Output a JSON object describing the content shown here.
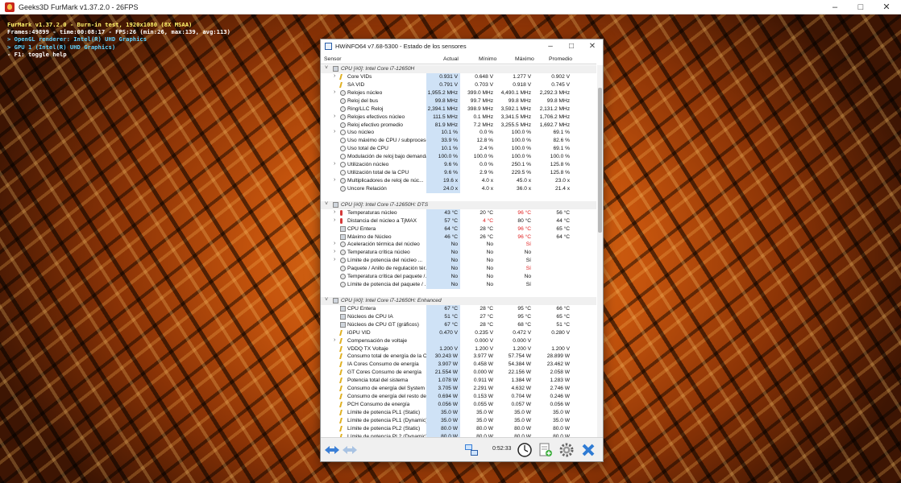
{
  "furmark": {
    "title": "Geeks3D FurMark v1.37.2.0 - 26FPS",
    "overlay": [
      {
        "text": "FurMark v1.37.2.0 - Burn-in test, 1920x1080 (8X MSAA)",
        "color": "yellow"
      },
      {
        "text": "Frames:49899 - time:00:08:17 - FPS:26 (min:26, max:139, avg:113)",
        "color": "white"
      },
      {
        "text": "> OpenGL renderer: Intel(R) UHD Graphics",
        "color": "cyan"
      },
      {
        "text": "> GPU 1 (Intel(R) UHD Graphics)",
        "color": "cyan"
      },
      {
        "text": "- F1: toggle help",
        "color": "white"
      }
    ]
  },
  "hwinfo": {
    "title": "HWiNFO64 v7.68-5300 - Estado de los sensores",
    "columns": {
      "sensor": "Sensor",
      "actual": "Actual",
      "min": "Mínimo",
      "max": "Máximo",
      "avg": "Promedio"
    },
    "rows": [
      {
        "type": "group",
        "name": "CPU [#0]: Intel Core i7-12650H"
      },
      {
        "type": "row",
        "exp": true,
        "icon": "volt",
        "name": "Core VIDs",
        "act": "0.931 V",
        "min": "0.648 V",
        "max": "1.277 V",
        "avg": "0.902 V"
      },
      {
        "type": "row",
        "exp": false,
        "icon": "volt",
        "name": "SA VID",
        "act": "0.791 V",
        "min": "0.703 V",
        "max": "0.918 V",
        "avg": "0.745 V"
      },
      {
        "type": "row",
        "exp": true,
        "icon": "clock",
        "name": "Relojes núcleo",
        "act": "1,955.2 MHz",
        "min": "399.0 MHz",
        "max": "4,490.1 MHz",
        "avg": "2,292.3 MHz"
      },
      {
        "type": "row",
        "exp": false,
        "icon": "clock",
        "name": "Reloj del bus",
        "act": "99.8 MHz",
        "min": "99.7 MHz",
        "max": "99.8 MHz",
        "avg": "99.8 MHz"
      },
      {
        "type": "row",
        "exp": false,
        "icon": "clock",
        "name": "Ring/LLC Reloj",
        "act": "2,394.1 MHz",
        "min": "398.9 MHz",
        "max": "3,592.1 MHz",
        "avg": "2,131.2 MHz"
      },
      {
        "type": "row",
        "exp": true,
        "icon": "clock",
        "name": "Relojes efectivos núcleo",
        "act": "111.5 MHz",
        "min": "0.1 MHz",
        "max": "3,341.5 MHz",
        "avg": "1,706.2 MHz"
      },
      {
        "type": "row",
        "exp": false,
        "icon": "clock",
        "name": "Reloj efectivo promedio",
        "act": "81.9 MHz",
        "min": "7.2 MHz",
        "max": "3,255.5 MHz",
        "avg": "1,692.7 MHz"
      },
      {
        "type": "row",
        "exp": true,
        "icon": "pct",
        "name": "Uso núcleo",
        "act": "10.1 %",
        "min": "0.0 %",
        "max": "100.0 %",
        "avg": "69.1 %"
      },
      {
        "type": "row",
        "exp": false,
        "icon": "pct",
        "name": "Uso máximo de CPU / subproceso",
        "act": "33.9 %",
        "min": "12.8 %",
        "max": "100.0 %",
        "avg": "82.6 %"
      },
      {
        "type": "row",
        "exp": false,
        "icon": "pct",
        "name": "Uso total de CPU",
        "act": "10.1 %",
        "min": "2.4 %",
        "max": "100.0 %",
        "avg": "69.1 %"
      },
      {
        "type": "row",
        "exp": false,
        "icon": "pct",
        "name": "Modulación de reloj bajo demanda",
        "act": "100.0 %",
        "min": "100.0 %",
        "max": "100.0 %",
        "avg": "100.0 %"
      },
      {
        "type": "row",
        "exp": true,
        "icon": "pct",
        "name": "Utilización núcleo",
        "act": "9.6 %",
        "min": "0.0 %",
        "max": "250.1 %",
        "avg": "125.8 %"
      },
      {
        "type": "row",
        "exp": false,
        "icon": "pct",
        "name": "Utilización total de la CPU",
        "act": "9.6 %",
        "min": "2.9 %",
        "max": "229.5 %",
        "avg": "125.8 %"
      },
      {
        "type": "row",
        "exp": true,
        "icon": "clock",
        "name": "Multiplicadores de reloj de núc...",
        "act": "19.6 x",
        "min": "4.0 x",
        "max": "45.0 x",
        "avg": "23.0 x"
      },
      {
        "type": "row",
        "exp": false,
        "icon": "clock",
        "name": "Uncore Relación",
        "act": "24.0 x",
        "min": "4.0 x",
        "max": "36.0 x",
        "avg": "21.4 x"
      },
      {
        "type": "spacer"
      },
      {
        "type": "group",
        "name": "CPU [#0]: Intel Core i7-12650H: DTS"
      },
      {
        "type": "row",
        "exp": true,
        "icon": "therm",
        "name": "Temperaturas núcleo",
        "act": "43 °C",
        "min": "20 °C",
        "max": "96 °C",
        "avg": "56 °C",
        "maxRed": true
      },
      {
        "type": "row",
        "exp": true,
        "icon": "therm",
        "name": "Distancia del núcleo a TjMAX",
        "act": "57 °C",
        "min": "4 °C",
        "max": "80 °C",
        "avg": "44 °C",
        "minRed": true
      },
      {
        "type": "row",
        "exp": false,
        "icon": "chip",
        "name": "CPU Entera",
        "act": "64 °C",
        "min": "28 °C",
        "max": "96 °C",
        "avg": "65 °C",
        "maxRed": true
      },
      {
        "type": "row",
        "exp": false,
        "icon": "chip",
        "name": "Máximo de Núcleo",
        "act": "46 °C",
        "min": "26 °C",
        "max": "96 °C",
        "avg": "64 °C",
        "maxRed": true
      },
      {
        "type": "row",
        "exp": true,
        "icon": "clock",
        "name": "Aceleración térmica del núcleo",
        "act": "No",
        "min": "No",
        "max": "Sí",
        "avg": "",
        "maxRed": true
      },
      {
        "type": "row",
        "exp": true,
        "icon": "clock",
        "name": "Temperatura crítica núcleo",
        "act": "No",
        "min": "No",
        "max": "No",
        "avg": ""
      },
      {
        "type": "row",
        "exp": true,
        "icon": "clock",
        "name": "Límite de potencia del núcleo ...",
        "act": "No",
        "min": "No",
        "max": "Sí",
        "avg": ""
      },
      {
        "type": "row",
        "exp": false,
        "icon": "clock",
        "name": "Paquete / Anillo de regulación tér...",
        "act": "No",
        "min": "No",
        "max": "Sí",
        "avg": "",
        "maxRed": true
      },
      {
        "type": "row",
        "exp": false,
        "icon": "clock",
        "name": "Temperatura crítica del paquete /...",
        "act": "No",
        "min": "No",
        "max": "No",
        "avg": ""
      },
      {
        "type": "row",
        "exp": false,
        "icon": "clock",
        "name": "Límite de potencia del paquete / ...",
        "act": "No",
        "min": "No",
        "max": "Sí",
        "avg": ""
      },
      {
        "type": "spacer"
      },
      {
        "type": "group",
        "name": "CPU [#0]: Intel Core i7-12650H: Enhanced"
      },
      {
        "type": "row",
        "exp": false,
        "icon": "chip",
        "name": "CPU Entera",
        "act": "67 °C",
        "min": "28 °C",
        "max": "95 °C",
        "avg": "66 °C"
      },
      {
        "type": "row",
        "exp": false,
        "icon": "chip",
        "name": "Núcleos de CPU IA",
        "act": "51 °C",
        "min": "27 °C",
        "max": "95 °C",
        "avg": "65 °C"
      },
      {
        "type": "row",
        "exp": false,
        "icon": "chip",
        "name": "Núcleos de CPU GT (gráficos)",
        "act": "67 °C",
        "min": "28 °C",
        "max": "68 °C",
        "avg": "51 °C"
      },
      {
        "type": "row",
        "exp": false,
        "icon": "volt",
        "name": "iGPU VID",
        "act": "0.470 V",
        "min": "0.235 V",
        "max": "0.472 V",
        "avg": "0.280 V"
      },
      {
        "type": "row",
        "exp": true,
        "icon": "volt",
        "name": "Compensación de voltaje",
        "act": "",
        "min": "0.000 V",
        "max": "0.000 V",
        "avg": ""
      },
      {
        "type": "row",
        "exp": false,
        "icon": "volt",
        "name": "VDDQ TX Voltaje",
        "act": "1.200 V",
        "min": "1.200 V",
        "max": "1.200 V",
        "avg": "1.200 V"
      },
      {
        "type": "row",
        "exp": false,
        "icon": "volt",
        "name": "Consumo total de energía de la CPU",
        "act": "30.243 W",
        "min": "3.977 W",
        "max": "57.754 W",
        "avg": "28.899 W"
      },
      {
        "type": "row",
        "exp": false,
        "icon": "volt",
        "name": "IA Cores Consumo de energía",
        "act": "3.907 W",
        "min": "0.458 W",
        "max": "54.384 W",
        "avg": "23.462 W"
      },
      {
        "type": "row",
        "exp": false,
        "icon": "volt",
        "name": "GT Cores Consumo de energía",
        "act": "21.554 W",
        "min": "0.000 W",
        "max": "22.156 W",
        "avg": "2.058 W"
      },
      {
        "type": "row",
        "exp": false,
        "icon": "volt",
        "name": "Potencia total del sistema",
        "act": "1.078 W",
        "min": "0.911 W",
        "max": "1.384 W",
        "avg": "1.283 W"
      },
      {
        "type": "row",
        "exp": false,
        "icon": "volt",
        "name": "Consumo de energía del System ...",
        "act": "3.705 W",
        "min": "2.291 W",
        "max": "4.632 W",
        "avg": "2.746 W"
      },
      {
        "type": "row",
        "exp": false,
        "icon": "volt",
        "name": "Consumo de energía del resto del...",
        "act": "0.694 W",
        "min": "0.153 W",
        "max": "0.704 W",
        "avg": "0.246 W"
      },
      {
        "type": "row",
        "exp": false,
        "icon": "volt",
        "name": "PCH Consumo de energía",
        "act": "0.056 W",
        "min": "0.055 W",
        "max": "0.057 W",
        "avg": "0.056 W"
      },
      {
        "type": "row",
        "exp": false,
        "icon": "volt",
        "name": "Límite de potencia PL1 (Static)",
        "act": "35.0 W",
        "min": "35.0 W",
        "max": "35.0 W",
        "avg": "35.0 W"
      },
      {
        "type": "row",
        "exp": false,
        "icon": "volt",
        "name": "Límite de potencia PL1 (Dynamic)",
        "act": "35.0 W",
        "min": "35.0 W",
        "max": "35.0 W",
        "avg": "35.0 W"
      },
      {
        "type": "row",
        "exp": false,
        "icon": "volt",
        "name": "Límite de potencia PL2 (Static)",
        "act": "80.0 W",
        "min": "80.0 W",
        "max": "80.0 W",
        "avg": "80.0 W"
      },
      {
        "type": "row",
        "exp": false,
        "icon": "volt",
        "name": "Límite de potencia PL2 (Dynamic)",
        "act": "80.0 W",
        "min": "80.0 W",
        "max": "80.0 W",
        "avg": "80.0 W"
      }
    ],
    "toolbar": {
      "elapsed": "0:52:33"
    }
  }
}
